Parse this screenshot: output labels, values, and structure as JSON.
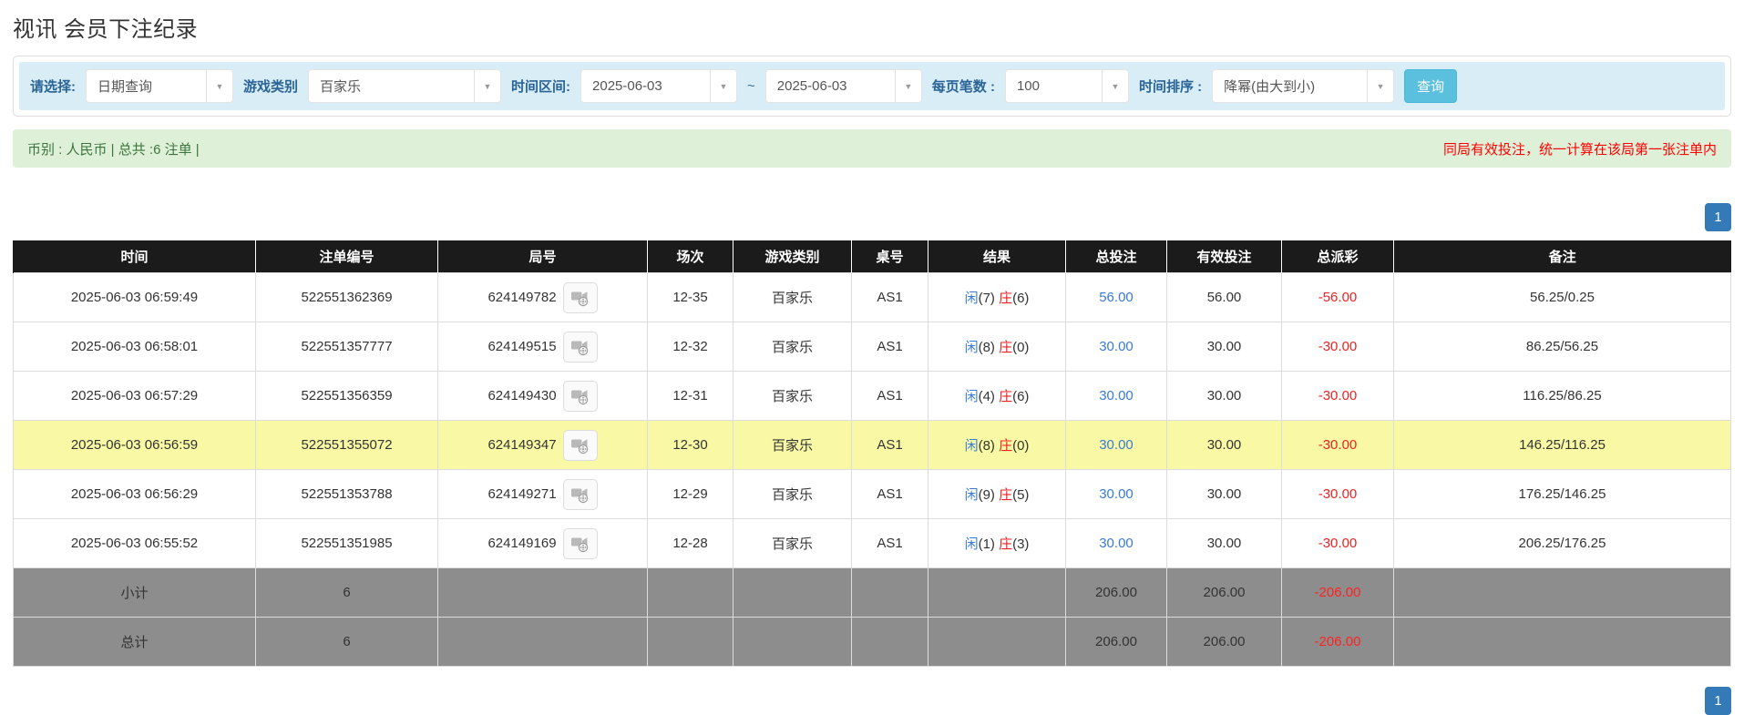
{
  "page_title": "视讯 会员下注纪录",
  "filters": {
    "query_type": {
      "label": "请选择:",
      "value": "日期查询"
    },
    "game_type": {
      "label": "游戏类别",
      "value": "百家乐"
    },
    "time_range": {
      "label": "时间区间:",
      "from": "2025-06-03",
      "separator": "~",
      "to": "2025-06-03"
    },
    "page_size": {
      "label": "每页笔数 :",
      "value": "100"
    },
    "time_sort": {
      "label": "时间排序 :",
      "value": "降幂(由大到小)"
    },
    "search_button": "查询"
  },
  "summary_bar": {
    "left_text": "币别 : 人民币 | 总共 :6 注单 |",
    "right_notice": "同局有效投注，统一计算在该局第一张注单内"
  },
  "pagination": {
    "page": "1"
  },
  "table": {
    "headers": [
      "时间",
      "注单编号",
      "局号",
      "场次",
      "游戏类别",
      "桌号",
      "结果",
      "总投注",
      "有效投注",
      "总派彩",
      "备注"
    ],
    "video_icon": "video-icon",
    "rows": [
      {
        "time": "2025-06-03 06:59:49",
        "bet_id": "522551362369",
        "round_id": "624149782",
        "session": "12-35",
        "game": "百家乐",
        "table_no": "AS1",
        "result": {
          "player_label": "闲",
          "player_value": "7",
          "banker_label": "庄",
          "banker_value": "6"
        },
        "total_bet": "56.00",
        "valid_bet": "56.00",
        "payout": "-56.00",
        "remark": "56.25/0.25",
        "highlighted": false
      },
      {
        "time": "2025-06-03 06:58:01",
        "bet_id": "522551357777",
        "round_id": "624149515",
        "session": "12-32",
        "game": "百家乐",
        "table_no": "AS1",
        "result": {
          "player_label": "闲",
          "player_value": "8",
          "banker_label": "庄",
          "banker_value": "0"
        },
        "total_bet": "30.00",
        "valid_bet": "30.00",
        "payout": "-30.00",
        "remark": "86.25/56.25",
        "highlighted": false
      },
      {
        "time": "2025-06-03 06:57:29",
        "bet_id": "522551356359",
        "round_id": "624149430",
        "session": "12-31",
        "game": "百家乐",
        "table_no": "AS1",
        "result": {
          "player_label": "闲",
          "player_value": "4",
          "banker_label": "庄",
          "banker_value": "6"
        },
        "total_bet": "30.00",
        "valid_bet": "30.00",
        "payout": "-30.00",
        "remark": "116.25/86.25",
        "highlighted": false
      },
      {
        "time": "2025-06-03 06:56:59",
        "bet_id": "522551355072",
        "round_id": "624149347",
        "session": "12-30",
        "game": "百家乐",
        "table_no": "AS1",
        "result": {
          "player_label": "闲",
          "player_value": "8",
          "banker_label": "庄",
          "banker_value": "0"
        },
        "total_bet": "30.00",
        "valid_bet": "30.00",
        "payout": "-30.00",
        "remark": "146.25/116.25",
        "highlighted": true
      },
      {
        "time": "2025-06-03 06:56:29",
        "bet_id": "522551353788",
        "round_id": "624149271",
        "session": "12-29",
        "game": "百家乐",
        "table_no": "AS1",
        "result": {
          "player_label": "闲",
          "player_value": "9",
          "banker_label": "庄",
          "banker_value": "5"
        },
        "total_bet": "30.00",
        "valid_bet": "30.00",
        "payout": "-30.00",
        "remark": "176.25/146.25",
        "highlighted": false
      },
      {
        "time": "2025-06-03 06:55:52",
        "bet_id": "522551351985",
        "round_id": "624149169",
        "session": "12-28",
        "game": "百家乐",
        "table_no": "AS1",
        "result": {
          "player_label": "闲",
          "player_value": "1",
          "banker_label": "庄",
          "banker_value": "3"
        },
        "total_bet": "30.00",
        "valid_bet": "30.00",
        "payout": "-30.00",
        "remark": "206.25/176.25",
        "highlighted": false
      }
    ],
    "subtotal": {
      "label": "小计",
      "count": "6",
      "total_bet": "206.00",
      "valid_bet": "206.00",
      "payout": "-206.00"
    },
    "total": {
      "label": "总计",
      "count": "6",
      "total_bet": "206.00",
      "valid_bet": "206.00",
      "payout": "-206.00"
    }
  },
  "colors": {
    "header_bg": "#1b1b1b",
    "highlight_row": "#f9f9a5",
    "summary_row_bg": "#8d8d8d",
    "link_blue": "#3a7bd5",
    "loss_red": "#ee2222",
    "filter_bar_bg": "#d9edf7",
    "filter_label_blue": "#2a6496",
    "green_bar_bg": "#dff0d8",
    "search_button_bg": "#5bc0de",
    "pagination_bg": "#337ab7"
  }
}
